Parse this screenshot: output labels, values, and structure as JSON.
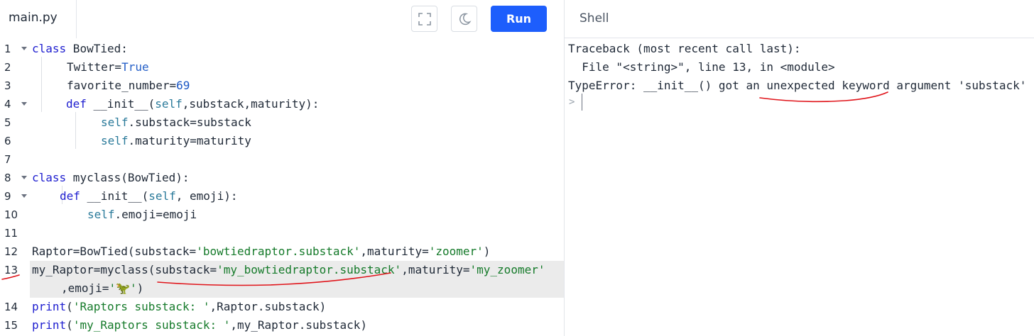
{
  "header": {
    "file_tab": "main.py",
    "fullscreen_icon": "fullscreen-icon",
    "theme_icon": "moon-icon",
    "run_label": "Run",
    "shell_title": "Shell"
  },
  "editor": {
    "lines": [
      {
        "n": "1",
        "text": "class BowTied:"
      },
      {
        "n": "2",
        "text": "Twitter=True"
      },
      {
        "n": "3",
        "text": "favorite_number=69"
      },
      {
        "n": "4",
        "text": "def __init__(self,substack,maturity):"
      },
      {
        "n": "5",
        "text": "self.substack=substack"
      },
      {
        "n": "6",
        "text": "self.maturity=maturity"
      },
      {
        "n": "7",
        "text": ""
      },
      {
        "n": "8",
        "text": "class myclass(BowTied):"
      },
      {
        "n": "9",
        "text": "def __init__(self, emoji):"
      },
      {
        "n": "10",
        "text": "self.emoji=emoji"
      },
      {
        "n": "11",
        "text": ""
      },
      {
        "n": "12",
        "text": "Raptor=BowTied(substack='bowtiedraptor.substack',maturity='zoomer')"
      },
      {
        "n": "13",
        "text": "my_Raptor=myclass(substack='my_bowtiedraptor.substack',maturity='my_zoomer'"
      },
      {
        "n": "",
        "text": ",emoji='🦖')"
      },
      {
        "n": "14",
        "text": "print('Raptors substack: ',Raptor.substack)"
      },
      {
        "n": "15",
        "text": "print('my_Raptors substack: ',my_Raptor.substack)"
      }
    ],
    "active_line": "13"
  },
  "shell": {
    "lines": [
      "Traceback (most recent call last):",
      "  File \"<string>\", line 13, in <module>",
      "TypeError: __init__() got an unexpected keyword argument 'substack'"
    ],
    "prompt": ">"
  },
  "colors": {
    "run_button": "#1d5efc",
    "annotation": "#e0141a",
    "keyword": "#2020d0",
    "string": "#157a2a"
  }
}
